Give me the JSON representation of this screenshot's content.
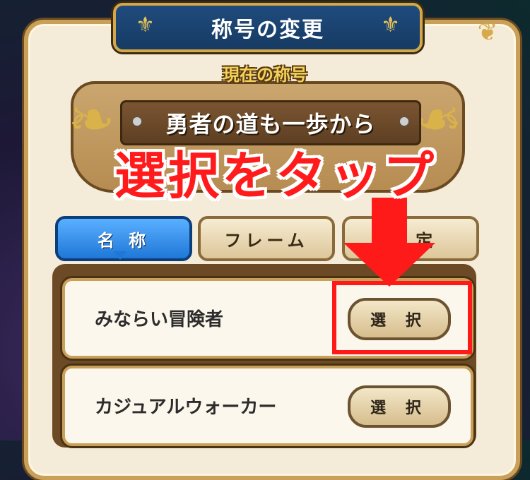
{
  "header": {
    "title": "称号の変更"
  },
  "current": {
    "label": "現在の称号",
    "title": "勇者の道も一歩から"
  },
  "annotation": {
    "text": "選択をタップ",
    "color": "#ff1b1b"
  },
  "tabs": [
    {
      "label": "名 称",
      "active": true
    },
    {
      "label": "フレーム",
      "active": false
    },
    {
      "label": "設 定",
      "active": false
    }
  ],
  "titles": [
    {
      "name": "みならい冒険者",
      "button": "選 択"
    },
    {
      "name": "カジュアルウォーカー",
      "button": "選 択"
    }
  ],
  "colors": {
    "accent_blue": "#1f78d8",
    "frame_gold": "#c9a05a",
    "highlight_red": "#ff1a1a"
  }
}
